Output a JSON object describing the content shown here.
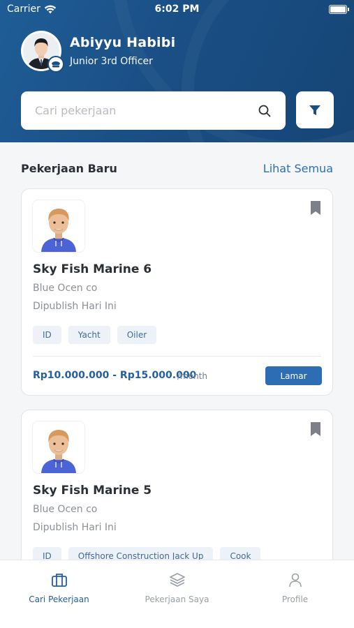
{
  "status_bar": {
    "carrier": "Carrier",
    "time": "6:02 PM"
  },
  "profile": {
    "name": "Abiyyu Habibi",
    "role": "Junior 3rd Officer"
  },
  "search": {
    "placeholder": "Cari pekerjaan",
    "value": ""
  },
  "section": {
    "title": "Pekerjaan Baru",
    "see_all": "Lihat Semua"
  },
  "jobs": [
    {
      "title": "Sky Fish Marine 6",
      "company": "Blue Ocen co",
      "published": "Dipublish Hari Ini",
      "tags": [
        "ID",
        "Yacht",
        "Oiler"
      ],
      "salary": "Rp10.000.000 - Rp15.000.000",
      "period": "/month",
      "apply_label": "Lamar"
    },
    {
      "title": "Sky Fish Marine 5",
      "company": "Blue Ocen co",
      "published": "Dipublish Hari Ini",
      "tags": [
        "ID",
        "Offshore Construction Jack Up",
        "Cook"
      ]
    }
  ],
  "tabs": [
    {
      "label": "Cari Pekerjaan",
      "icon": "briefcase-icon",
      "active": true
    },
    {
      "label": "Pekerjaan Saya",
      "icon": "layers-icon",
      "active": false
    },
    {
      "label": "Profile",
      "icon": "user-icon",
      "active": false
    }
  ],
  "colors": {
    "header": "#1a4f85",
    "accent": "#2d6db4",
    "tag_bg": "#edf2f8"
  }
}
